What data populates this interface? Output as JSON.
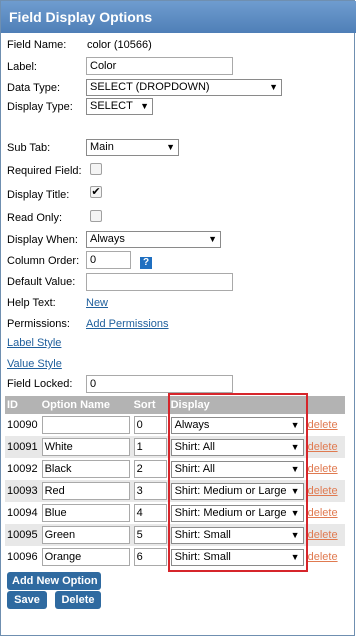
{
  "header": {
    "title": "Field Display Options"
  },
  "form": {
    "field_name_label": "Field Name:",
    "field_name_value": "color (10566)",
    "label_label": "Label:",
    "label_value": "Color",
    "data_type_label": "Data Type:",
    "data_type_value": "SELECT (DROPDOWN)",
    "display_type_label": "Display Type:",
    "display_type_value": "SELECT",
    "sub_tab_label": "Sub Tab:",
    "sub_tab_value": "Main",
    "required_label": "Required Field:",
    "required_checked": false,
    "display_title_label": "Display Title:",
    "display_title_checked": true,
    "read_only_label": "Read Only:",
    "read_only_checked": false,
    "display_when_label": "Display When:",
    "display_when_value": "Always",
    "column_order_label": "Column Order:",
    "column_order_value": "0",
    "help_icon_text": "?",
    "default_value_label": "Default Value:",
    "default_value_value": "",
    "help_text_label": "Help Text:",
    "help_text_link": "New",
    "permissions_label": "Permissions:",
    "permissions_link": "Add Permissions",
    "label_style_link": "Label Style",
    "value_style_link": "Value Style",
    "field_locked_label": "Field Locked:",
    "field_locked_value": "0"
  },
  "options_table": {
    "columns": [
      "ID",
      "Option Name",
      "Sort",
      "Display"
    ],
    "delete_label": "delete",
    "rows": [
      {
        "id": "10090",
        "name": "",
        "sort": "0",
        "display": "Always"
      },
      {
        "id": "10091",
        "name": "White",
        "sort": "1",
        "display": "Shirt: All"
      },
      {
        "id": "10092",
        "name": "Black",
        "sort": "2",
        "display": "Shirt: All"
      },
      {
        "id": "10093",
        "name": "Red",
        "sort": "3",
        "display": "Shirt: Medium or Large"
      },
      {
        "id": "10094",
        "name": "Blue",
        "sort": "4",
        "display": "Shirt: Medium or Large"
      },
      {
        "id": "10095",
        "name": "Green",
        "sort": "5",
        "display": "Shirt: Small"
      },
      {
        "id": "10096",
        "name": "Orange",
        "sort": "6",
        "display": "Shirt: Small"
      }
    ]
  },
  "buttons": {
    "add_option": "Add New Option",
    "save": "Save",
    "delete": "Delete"
  },
  "colors": {
    "header_bg": "#5585bd",
    "button_bg": "#2f6aa0",
    "highlight_border": "#d6252b",
    "delete_link": "#e07a50",
    "link": "#1f5f9c"
  },
  "icons": {
    "dropdown": "triangle-down-icon",
    "help": "question-icon",
    "checkbox": "checkmark-icon"
  }
}
